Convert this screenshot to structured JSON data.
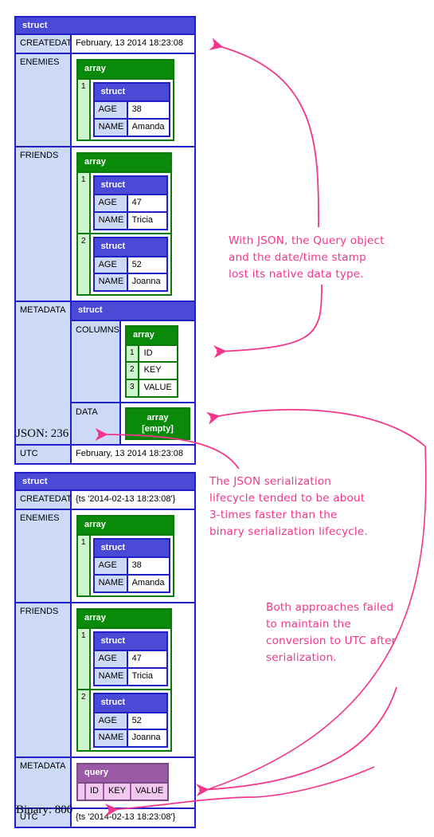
{
  "colors": {
    "struct_header": "#4a4ad6",
    "struct_border": "#2020c8",
    "key_cell": "#ccd9f7",
    "array_header": "#0a8a0a",
    "array_border": "#0a7a0a",
    "array_index": "#ccf5cc",
    "query_header": "#9a5aa5",
    "query_cell": "#f0c8f0",
    "annotation_pink": "#f5358c"
  },
  "labels": {
    "struct": "struct",
    "array": "array",
    "array_empty": "array [empty]",
    "query": "query"
  },
  "json_dump": {
    "root_type": "struct",
    "rows": [
      {
        "key": "CREATEDAT",
        "value": "February, 13 2014 18:23:08"
      },
      {
        "key": "ENEMIES",
        "value": ""
      },
      {
        "key": "FRIENDS",
        "value": ""
      },
      {
        "key": "METADATA",
        "value": ""
      },
      {
        "key": "UTC",
        "value": "February, 13 2014 18:23:08"
      }
    ],
    "enemies": [
      {
        "index": "1",
        "fields": [
          {
            "k": "AGE",
            "v": "38"
          },
          {
            "k": "NAME",
            "v": "Amanda"
          }
        ]
      }
    ],
    "friends": [
      {
        "index": "1",
        "fields": [
          {
            "k": "AGE",
            "v": "47"
          },
          {
            "k": "NAME",
            "v": "Tricia"
          }
        ]
      },
      {
        "index": "2",
        "fields": [
          {
            "k": "AGE",
            "v": "52"
          },
          {
            "k": "NAME",
            "v": "Joanna"
          }
        ]
      }
    ],
    "metadata": {
      "type": "struct",
      "columns_key": "COLUMNS",
      "columns": [
        {
          "index": "1",
          "value": "ID"
        },
        {
          "index": "2",
          "value": "KEY"
        },
        {
          "index": "3",
          "value": "VALUE"
        }
      ],
      "data_key": "DATA",
      "data_value": "array [empty]"
    },
    "size_caption": "JSON: 236"
  },
  "binary_dump": {
    "root_type": "struct",
    "rows": [
      {
        "key": "CREATEDAT",
        "value": "{ts '2014-02-13 18:23:08'}"
      },
      {
        "key": "ENEMIES",
        "value": ""
      },
      {
        "key": "FRIENDS",
        "value": ""
      },
      {
        "key": "METADATA",
        "value": ""
      },
      {
        "key": "UTC",
        "value": "{ts '2014-02-13 18:23:08'}"
      }
    ],
    "enemies": [
      {
        "index": "1",
        "fields": [
          {
            "k": "AGE",
            "v": "38"
          },
          {
            "k": "NAME",
            "v": "Amanda"
          }
        ]
      }
    ],
    "friends": [
      {
        "index": "1",
        "fields": [
          {
            "k": "AGE",
            "v": "47"
          },
          {
            "k": "NAME",
            "v": "Tricia"
          }
        ]
      },
      {
        "index": "2",
        "fields": [
          {
            "k": "AGE",
            "v": "52"
          },
          {
            "k": "NAME",
            "v": "Joanna"
          }
        ]
      }
    ],
    "metadata": {
      "type": "query",
      "columns": [
        "ID",
        "KEY",
        "VALUE"
      ]
    },
    "size_caption": "Binary: 800"
  },
  "notes": {
    "note1": "With JSON, the Query object\nand the date/time stamp\nlost its native data type.",
    "note2": "The JSON serialization\nlifecycle tended to be about\n3-times faster than the\nbinary serialization lifecycle.",
    "note3": "Both approaches failed\nto maintain the\nconversion to UTC after\nserialization."
  }
}
